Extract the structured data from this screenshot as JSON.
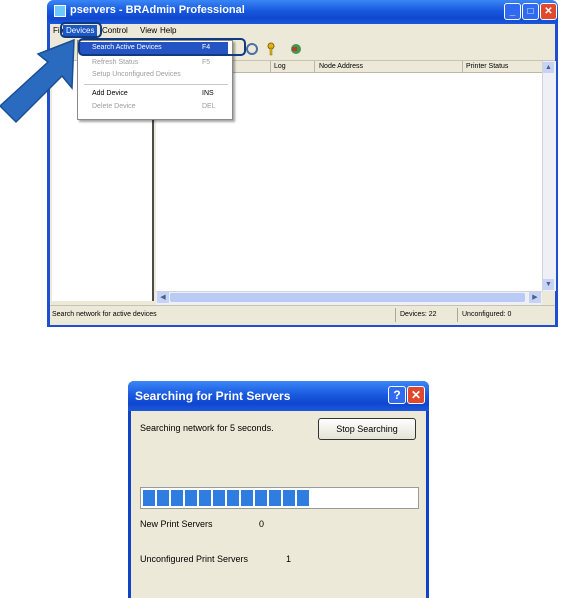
{
  "window": {
    "title": "pservers - BRAdmin Professional",
    "controls": {
      "minimize": "_",
      "maximize": "□",
      "close": "✕"
    }
  },
  "menubar": {
    "file": "File",
    "devices": "Devices",
    "control": "Control",
    "view": "View",
    "help": "Help"
  },
  "dropdown": {
    "items": [
      {
        "label": "Search Active Devices",
        "shortcut": "F4",
        "enabled": true,
        "selected": true
      },
      {
        "label": "Refresh Status",
        "shortcut": "F5",
        "enabled": false
      },
      {
        "label": "Setup Unconfigured Devices",
        "shortcut": "",
        "enabled": false
      },
      {
        "label": "Add Device",
        "shortcut": "INS",
        "enabled": true
      },
      {
        "label": "Delete Device",
        "shortcut": "DEL",
        "enabled": false
      }
    ]
  },
  "list": {
    "columns": [
      "Log",
      "Node Address",
      "Printer Status"
    ]
  },
  "statusbar": {
    "message": "Search network for active devices",
    "devices": "Devices: 22",
    "unconfigured": "Unconfigured: 0"
  },
  "dialog": {
    "title": "Searching for Print Servers",
    "help": "?",
    "close": "✕",
    "message": "Searching network for 5 seconds.",
    "stop_button": "Stop Searching",
    "progress_fraction": 0.63,
    "new_label": "New Print Servers",
    "new_value": "0",
    "unconfigured_label": "Unconfigured Print Servers",
    "unconfigured_value": "1"
  },
  "colors": {
    "xp_title_blue": "#1858df",
    "menu_highlight": "#2453c3",
    "progress_block": "#2f7de0",
    "callout_arrow": "#2a6bbf"
  }
}
